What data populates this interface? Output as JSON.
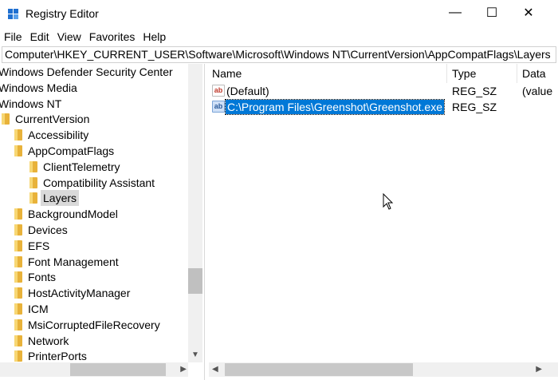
{
  "window": {
    "title": "Registry Editor",
    "minimize_glyph": "—",
    "maximize_glyph": "☐",
    "close_glyph": "✕"
  },
  "menu": [
    "File",
    "Edit",
    "View",
    "Favorites",
    "Help"
  ],
  "address": "Computer\\HKEY_CURRENT_USER\\Software\\Microsoft\\Windows NT\\CurrentVersion\\AppCompatFlags\\Layers",
  "tree": [
    {
      "label": "Windows Defender Security Center",
      "level": 0,
      "chevron": "",
      "folder": false
    },
    {
      "label": "Windows Media",
      "level": 0,
      "chevron": "",
      "folder": false
    },
    {
      "label": "Windows NT",
      "level": 0,
      "chevron": "",
      "folder": false
    },
    {
      "label": "CurrentVersion",
      "level": 1,
      "chevron": "",
      "folder": true
    },
    {
      "label": "Accessibility",
      "level": 2,
      "chevron": "",
      "folder": true
    },
    {
      "label": "AppCompatFlags",
      "level": 2,
      "chevron": "⌄",
      "folder": true
    },
    {
      "label": "ClientTelemetry",
      "level": 3,
      "chevron": "›",
      "folder": true
    },
    {
      "label": "Compatibility Assistant",
      "level": 3,
      "chevron": "›",
      "folder": true
    },
    {
      "label": "Layers",
      "level": 3,
      "chevron": "",
      "folder": true,
      "selected": true
    },
    {
      "label": "BackgroundModel",
      "level": 2,
      "chevron": "›",
      "folder": true
    },
    {
      "label": "Devices",
      "level": 2,
      "chevron": "›",
      "folder": true
    },
    {
      "label": "EFS",
      "level": 2,
      "chevron": "›",
      "folder": true
    },
    {
      "label": "Font Management",
      "level": 2,
      "chevron": "›",
      "folder": true
    },
    {
      "label": "Fonts",
      "level": 2,
      "chevron": "›",
      "folder": true
    },
    {
      "label": "HostActivityManager",
      "level": 2,
      "chevron": "›",
      "folder": true
    },
    {
      "label": "ICM",
      "level": 2,
      "chevron": "›",
      "folder": true
    },
    {
      "label": "MsiCorruptedFileRecovery",
      "level": 2,
      "chevron": "›",
      "folder": true
    },
    {
      "label": "Network",
      "level": 2,
      "chevron": "›",
      "folder": true
    },
    {
      "label": "PrinterPorts",
      "level": 2,
      "chevron": "›",
      "folder": true
    }
  ],
  "list": {
    "columns": {
      "name": "Name",
      "type": "Type",
      "data": "Data"
    },
    "rows": [
      {
        "icon": "ab",
        "name": "(Default)",
        "type": "REG_SZ",
        "data": "(value",
        "selected": false
      },
      {
        "icon": "ab",
        "name": "C:\\Program Files\\Greenshot\\Greenshot.exe",
        "type": "REG_SZ",
        "data": "",
        "selected": true
      }
    ]
  },
  "colors": {
    "selection": "#0078d7",
    "folder": "#e8b23a"
  }
}
